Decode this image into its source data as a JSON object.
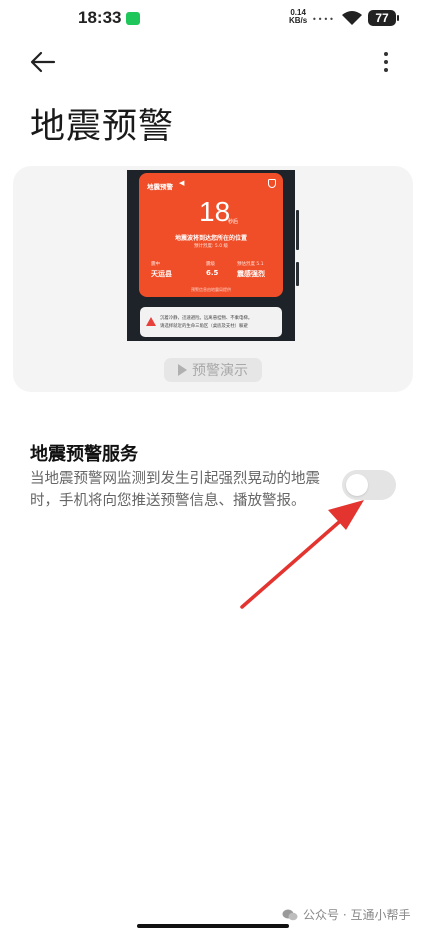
{
  "status_bar": {
    "time": "18:33",
    "speed_value": "0.14",
    "speed_unit": "KB/s",
    "battery": "77"
  },
  "header": {
    "title": "地震预警"
  },
  "preview": {
    "alert_title": "地震预警",
    "countdown": "18",
    "countdown_unit": "秒后",
    "message": "地震波将到达您所在的位置",
    "sub_message": "预计烈度: 5.0 级",
    "col1_label": "震中",
    "col1_value": "天运县",
    "col2_label": "震级",
    "col2_value": "6.5",
    "col3_label": "预估烈度 5.1",
    "col3_value": "震感强烈",
    "footer": "预警信息由地震局提供",
    "tip_line1": "沉着冷静，迅速避险。远离悬挂物、不乘电梯。",
    "tip_line2": "请选择就近的生命三角区（桌底及支柱）躲避",
    "demo_label": "预警演示",
    "accent_color": "#f04e28"
  },
  "service": {
    "title": "地震预警服务",
    "description": "当地震预警网监测到发生引起强烈晃动的地震时，手机将向您推送预警信息、播放警报。",
    "enabled": false
  },
  "annotation": {
    "arrow_color": "#e3342f"
  },
  "footer": {
    "watermark": "公众号 · 互通小帮手"
  }
}
